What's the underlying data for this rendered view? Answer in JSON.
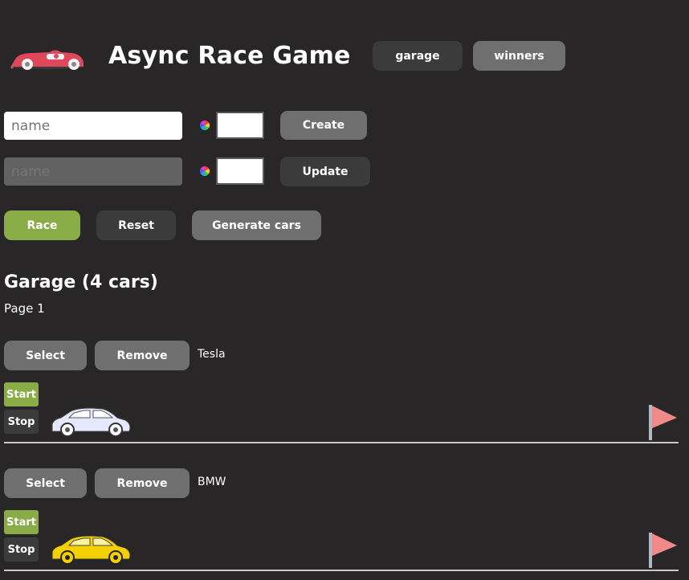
{
  "header": {
    "title": "Async Race Game",
    "nav": {
      "garage": "garage",
      "winners": "winners"
    }
  },
  "create_form": {
    "placeholder": "name",
    "value": "",
    "button": "Create"
  },
  "update_form": {
    "placeholder": "name",
    "value": "",
    "button": "Update"
  },
  "controls": {
    "race": "Race",
    "reset": "Reset",
    "generate": "Generate cars"
  },
  "garage": {
    "heading": "Garage (4 cars)",
    "page": "Page 1"
  },
  "cars": [
    {
      "name": "Tesla",
      "select": "Select",
      "remove": "Remove",
      "start": "Start",
      "stop": "Stop",
      "color": "#e6e8ff"
    },
    {
      "name": "BMW",
      "select": "Select",
      "remove": "Remove",
      "start": "Start",
      "stop": "Stop",
      "color": "#f5d000"
    }
  ],
  "colors": {
    "accent_green": "#8aac46",
    "flag": "#f08a8a",
    "background": "#282627"
  }
}
